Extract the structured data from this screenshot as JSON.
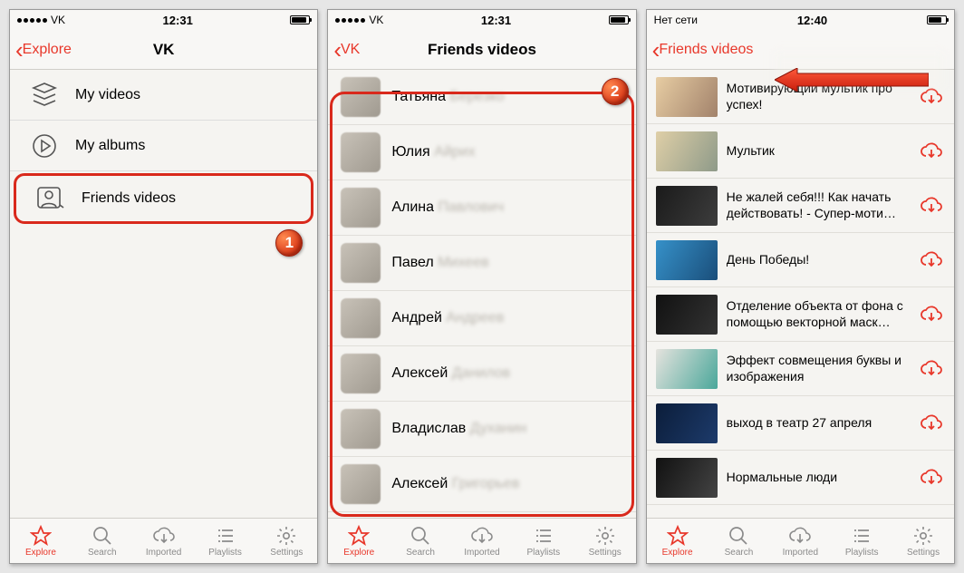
{
  "screen1": {
    "status": {
      "carrier": "VK",
      "time": "12:31"
    },
    "nav": {
      "back": "Explore",
      "title": "VK"
    },
    "menu": [
      {
        "id": "my-videos",
        "label": "My videos"
      },
      {
        "id": "my-albums",
        "label": "My albums"
      },
      {
        "id": "friends-videos",
        "label": "Friends videos"
      }
    ]
  },
  "screen2": {
    "status": {
      "carrier": "VK",
      "time": "12:31"
    },
    "nav": {
      "back": "VK",
      "title": "Friends videos"
    },
    "friends": [
      {
        "first": "Татьяна",
        "rest": "Березко"
      },
      {
        "first": "Юлия",
        "rest": "Айрих"
      },
      {
        "first": "Алина",
        "rest": "Павлович"
      },
      {
        "first": "Павел",
        "rest": "Михеев"
      },
      {
        "first": "Андрей",
        "rest": "Андреев"
      },
      {
        "first": "Алексей",
        "rest": "Данилов"
      },
      {
        "first": "Владислав",
        "rest": "Духанин"
      },
      {
        "first": "Алексей",
        "rest": "Григорьев"
      }
    ]
  },
  "screen3": {
    "status": {
      "carrier": "Нет сети",
      "time": "12:40"
    },
    "nav": {
      "back": "Friends videos",
      "title": ""
    },
    "videos": [
      "Мотивирующий мультик про успех!",
      "Мультик",
      "Не жалей себя!!! Как начать действовать! - Супер-моти…",
      "День Победы!",
      "Отделение объекта от фона с помощью векторной маск…",
      "Эффект совмещения буквы и изображения",
      "выход в театр 27 апреля",
      "Нормальные люди"
    ],
    "thumb_styles": [
      "linear-gradient(120deg,#e7cda3,#a2826b)",
      "linear-gradient(120deg,#dfcfa7,#8e9a89)",
      "linear-gradient(120deg,#1a1a1a,#3d3d3d)",
      "linear-gradient(120deg,#3691c9,#1a4e7a)",
      "linear-gradient(120deg,#111,#333)",
      "linear-gradient(120deg,#e5e3de,#4aa79a)",
      "linear-gradient(120deg,#0b1d3a,#1d3b6b)",
      "linear-gradient(120deg,#111,#444)"
    ]
  },
  "tabs": [
    {
      "id": "explore",
      "label": "Explore"
    },
    {
      "id": "search",
      "label": "Search"
    },
    {
      "id": "imported",
      "label": "Imported"
    },
    {
      "id": "playlists",
      "label": "Playlists"
    },
    {
      "id": "settings",
      "label": "Settings"
    }
  ],
  "badges": {
    "one": "1",
    "two": "2"
  }
}
